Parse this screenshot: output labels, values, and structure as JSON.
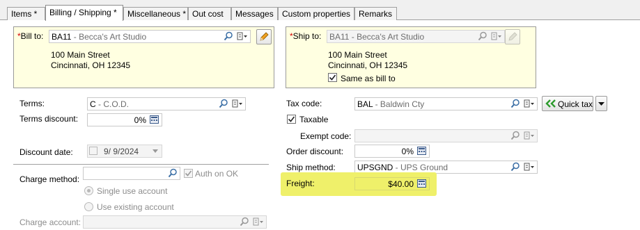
{
  "tabs": [
    {
      "label": "Items *"
    },
    {
      "label": "Billing / Shipping *"
    },
    {
      "label": "Miscellaneous *"
    },
    {
      "label": "Out cost"
    },
    {
      "label": "Messages"
    },
    {
      "label": "Custom properties"
    },
    {
      "label": "Remarks"
    }
  ],
  "bill_to": {
    "label": "Bill to:",
    "required_mark": "*",
    "code": "BA11",
    "name": " - Becca's Art Studio",
    "address_line1": "100 Main Street",
    "address_line2": "Cincinnati, OH 12345"
  },
  "ship_to": {
    "label": "Ship to:",
    "required_mark": "*",
    "code": "BA11",
    "name": " - Becca's Art Studio",
    "address_line1": "100 Main Street",
    "address_line2": "Cincinnati, OH 12345",
    "same_as_bill_label": "Same as bill to",
    "same_as_bill_checked": true
  },
  "left": {
    "terms_label": "Terms:",
    "terms_code": "C",
    "terms_desc": " - C.O.D.",
    "terms_discount_label": "Terms discount:",
    "terms_discount_value": "0%",
    "discount_date_label": "Discount date:",
    "discount_date_value": "9/ 9/2024",
    "charge_method_label": "Charge method:",
    "auth_on_ok_label": "Auth on OK",
    "single_use_label": "Single use account",
    "existing_account_label": "Use existing account",
    "charge_account_label": "Charge account:"
  },
  "right": {
    "tax_code_label": "Tax code:",
    "tax_code": "BAL",
    "tax_desc": " - Baldwin Cty",
    "quick_tax_label": "Quick tax",
    "taxable_label": "Taxable",
    "taxable_checked": true,
    "exempt_code_label": "Exempt code:",
    "order_discount_label": "Order discount:",
    "order_discount_value": "0%",
    "ship_method_label": "Ship method:",
    "ship_method_code": "UPSGND",
    "ship_method_desc": " - UPS Ground",
    "freight_label": "Freight:",
    "freight_value": "$40.00"
  },
  "colors": {
    "highlight": "#eff06a",
    "address_bg": "#ffffe1",
    "required": "#d40000",
    "quick_tax_arrow": "#2e9b2e"
  }
}
